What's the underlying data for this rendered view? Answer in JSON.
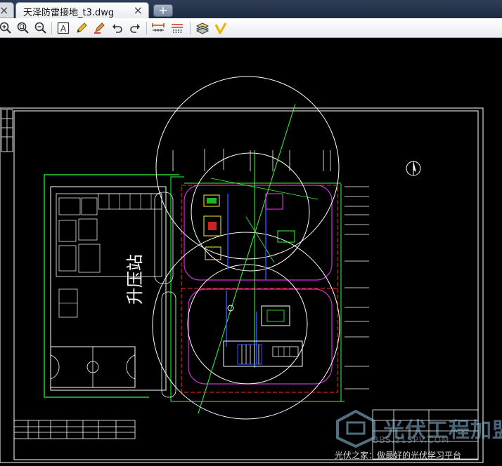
{
  "tabs": {
    "active_title": "天泽防雷接地_t3.dwg",
    "close_glyph": "×",
    "new_tab_glyph": "+"
  },
  "toolbar": {
    "icons": [
      "zoom-in-icon",
      "zoom-window-icon",
      "zoom-out-icon",
      "text-icon",
      "pencil-icon",
      "highlighter-icon",
      "undo-icon",
      "redo-icon",
      "measure-icon",
      "measure-area-icon",
      "layers-icon",
      "check-icon"
    ]
  },
  "drawing": {
    "station_label": "升压站",
    "north_symbol": "N"
  },
  "watermark": {
    "title": "光伏工程加盟",
    "url": "BBS.21SPV.COM",
    "slogan": "光伏之家：做最好的光伏学习平台"
  },
  "colors": {
    "canvas_bg": "#000000",
    "outline_white": "#ffffff",
    "grounding_green": "#33ff33",
    "boundary_red": "#ff2a2a",
    "road_magenta": "#cc33cc",
    "cable_blue": "#3355ff",
    "accent_yellow": "#ffee33"
  }
}
